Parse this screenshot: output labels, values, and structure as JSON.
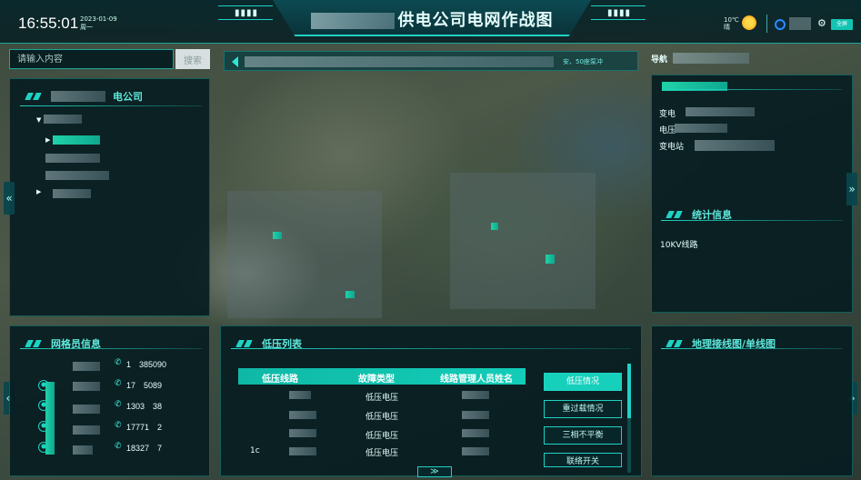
{
  "header": {
    "clock": "16:55:01",
    "date": "2023-01-09",
    "weekday": "周一",
    "title": "供电公司电网作战图",
    "deco_left": "▮▮▮▮",
    "deco_right": "▮▮▮▮",
    "weather_temp": "10℃",
    "weather_desc": "晴",
    "sun_icon": "sun-icon",
    "fullscreen_label": "全屏"
  },
  "search": {
    "placeholder": "请输入内容",
    "button_label": "搜索"
  },
  "notice": {
    "text": "安、50座泵冲"
  },
  "org_panel": {
    "title": "电公司"
  },
  "station_panel": {
    "title": "导航",
    "labels": [
      "变电",
      "电压",
      "变电站"
    ]
  },
  "stats_panel": {
    "title": "统计信息",
    "label": "10KV线路"
  },
  "grid_members": {
    "title": "网格员信息",
    "phones": [
      "1　385090",
      "17　5089",
      "1303　38",
      "17771　2",
      "18327　7"
    ]
  },
  "low_voltage": {
    "title": "低压列表",
    "columns": [
      "低压线路",
      "故障类型",
      "线路管理人员姓名"
    ],
    "rows": [
      {
        "line": "",
        "fault": "低压电压",
        "manager": ""
      },
      {
        "line": "",
        "fault": "低压电压",
        "manager": ""
      },
      {
        "line": "",
        "fault": "低压电压",
        "manager": ""
      },
      {
        "line": "1c",
        "fault": "低压电压",
        "manager": ""
      }
    ],
    "buttons": [
      "低压情况",
      "重过载情况",
      "三相不平衡",
      "联络开关"
    ]
  },
  "wiring_panel": {
    "title": "地理接线图/单线图"
  },
  "toggles": {
    "left": "«",
    "right": "»",
    "expand": "≫"
  },
  "colors": {
    "accent": "#1fd2c4",
    "panel_bg": "#061c20",
    "button_active": "#17d0bc"
  }
}
